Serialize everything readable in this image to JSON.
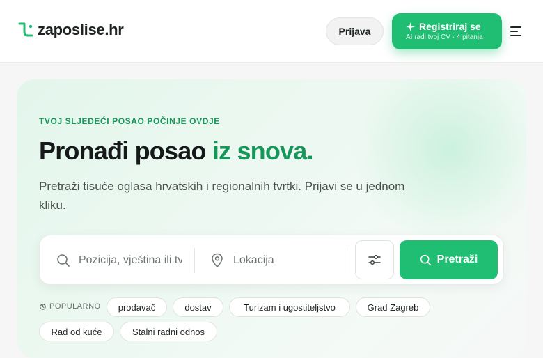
{
  "header": {
    "logo_text": "zaposlise.hr",
    "login_label": "Prijava",
    "register_label": "Registriraj se",
    "register_sub": "AI radi tvoj CV · 4 pitanja"
  },
  "hero": {
    "eyebrow": "TVOJ SLJEDEĆI POSAO POČINJE OVDJE",
    "title_main": "Pronađi posao ",
    "title_accent": "iz snova.",
    "subtitle": "Pretraži tisuće oglasa hrvatskih i regionalnih tvrtki. Prijavi se u jednom kliku."
  },
  "search": {
    "position_placeholder": "Pozicija, vještina ili tvrtka",
    "location_placeholder": "Lokacija",
    "submit_label": "Pretraži"
  },
  "popular": {
    "label": "POPULARNO",
    "chips": [
      "prodavač",
      "dostav",
      "Turizam i ugostiteljstvo",
      "Grad Zagreb",
      "Rad od kuće",
      "Stalni radni odnos"
    ]
  },
  "colors": {
    "accent": "#1fbe73",
    "accent_dark": "#17965a"
  }
}
